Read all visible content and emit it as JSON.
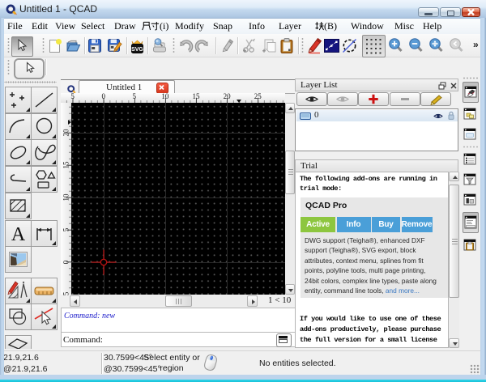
{
  "window": {
    "title": "Untitled 1 - QCAD",
    "caption_buttons": [
      "minimize",
      "maximize",
      "close"
    ]
  },
  "menu": {
    "items": [
      {
        "label": "File"
      },
      {
        "label": "Edit"
      },
      {
        "label": "View"
      },
      {
        "label": "Select"
      },
      {
        "label": "Draw"
      },
      {
        "label": "尺寸(i)"
      },
      {
        "label": "Modify"
      },
      {
        "label": "Snap"
      },
      {
        "label": "Info"
      },
      {
        "label": "Layer"
      },
      {
        "label": "块(B)"
      },
      {
        "label": "Window"
      },
      {
        "label": "Misc"
      },
      {
        "label": "Help"
      }
    ]
  },
  "toolbar": {
    "overflow_chevron": "»",
    "svg_icon_text": "SVG",
    "icons": [
      "selection-pointer",
      "new-file",
      "open-file",
      "save",
      "save-as",
      "svg-export",
      "print-preview",
      "undo",
      "redo",
      "erase",
      "cut",
      "copy",
      "paste",
      "edit-properties",
      "polyline-edit",
      "break-out-segment",
      "grid-toggle",
      "zoom-in",
      "zoom-out",
      "auto-zoom",
      "previous-view",
      "overflow-chevron"
    ]
  },
  "left_toolbox": {
    "text_tool_glyph": "A",
    "tools": [
      "selection-arrow",
      "point",
      "line",
      "arc",
      "circle",
      "ellipse",
      "spline",
      "polyline",
      "shape",
      "hatch",
      "text",
      "dimension",
      "image",
      "measure",
      "info-ruler",
      "boolean-shapes",
      "deselect-arrow",
      "isometric-projection"
    ]
  },
  "drawing": {
    "tab_label": "Untitled 1",
    "zoom_indicator": "1 < 10",
    "h_ruler_labels": [
      "5",
      "0",
      "5",
      "10",
      "15",
      "20",
      "25"
    ],
    "v_ruler_labels": [
      "20",
      "15",
      "10",
      "5",
      "0",
      "5"
    ]
  },
  "command": {
    "history_line": "Command: new",
    "prompt": "Command:",
    "input_value": ""
  },
  "layer_panel": {
    "title": "Layer List",
    "toolbar_icons": [
      "show-all-layers",
      "hide-all-layers",
      "add-layer",
      "remove-layer",
      "edit-layer"
    ],
    "layers": [
      {
        "name": "0",
        "visible": true,
        "locked": false
      }
    ]
  },
  "trial_panel": {
    "title": "Trial",
    "intro_lines": [
      "The following add-ons are running in",
      "trial mode:"
    ],
    "card": {
      "name": "QCAD Pro",
      "buttons": [
        {
          "label": "Active",
          "color": "#8dc63f"
        },
        {
          "label": "Info",
          "color": "#4a9fd8"
        },
        {
          "label": "Buy",
          "color": "#4a9fd8"
        },
        {
          "label": "Remove",
          "color": "#4a9fd8"
        }
      ],
      "description_lines": [
        "DWG support (Teigha®), enhanced DXF",
        "support (Teigha®), SVG export, block",
        "attributes, context menu, splines from fit",
        "points, polyline tools, multi page printing,",
        "24bit colors, complex line types, paste along",
        "entity, command line tools, "
      ],
      "more_link": "and more..."
    },
    "outro_lines": [
      "If you would like to use one of these",
      "add-ons productively, please purchase",
      "the full version for a small license"
    ]
  },
  "right_toolbar": {
    "icons": [
      "layer-list-toggle",
      "block-list-toggle",
      "property-editor-empty",
      "property-editor-list",
      "selection-filter",
      "library-browser",
      "command-line-toggle",
      "clipboard-panel"
    ],
    "pressed": [
      "layer-list-toggle",
      "command-line-toggle"
    ]
  },
  "statusbar": {
    "abs_coord": "21.9,21.6",
    "rel_coord": "@21.9,21.6",
    "polar_coord": "30.7599<45°",
    "polar_rel_coord": "@30.7599<45°",
    "hint_line1": "Select entity or",
    "hint_line2": "region",
    "selection_info": "No entities selected."
  },
  "colors": {
    "titlebar": "#bdd4ea",
    "canvas_bg": "#000000",
    "crosshair": "#cc1111",
    "active_green": "#8dc63f",
    "addon_blue": "#4a9fd8",
    "close_red": "#d3361c"
  }
}
